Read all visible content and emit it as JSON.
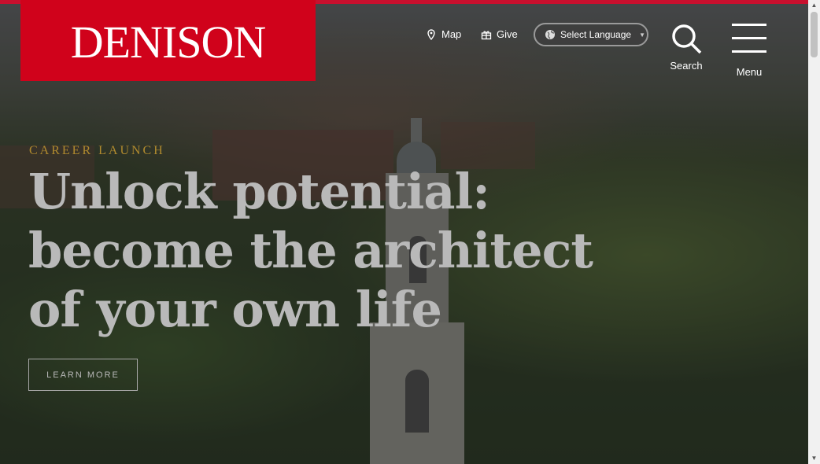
{
  "brand": {
    "logo_text": "DENISON",
    "accent": "#d0021b"
  },
  "utility_nav": {
    "map": {
      "label": "Map",
      "icon": "map-pin-icon"
    },
    "give": {
      "label": "Give",
      "icon": "gift-icon"
    },
    "language": {
      "label": "Select Language",
      "icon": "globe-icon"
    },
    "search": {
      "label": "Search",
      "icon": "search-icon"
    },
    "menu": {
      "label": "Menu",
      "icon": "hamburger-icon"
    }
  },
  "hero": {
    "eyebrow": "CAREER LAUNCH",
    "headline": "Unlock potential: become the architect of your own life",
    "cta_label": "LEARN MORE"
  }
}
